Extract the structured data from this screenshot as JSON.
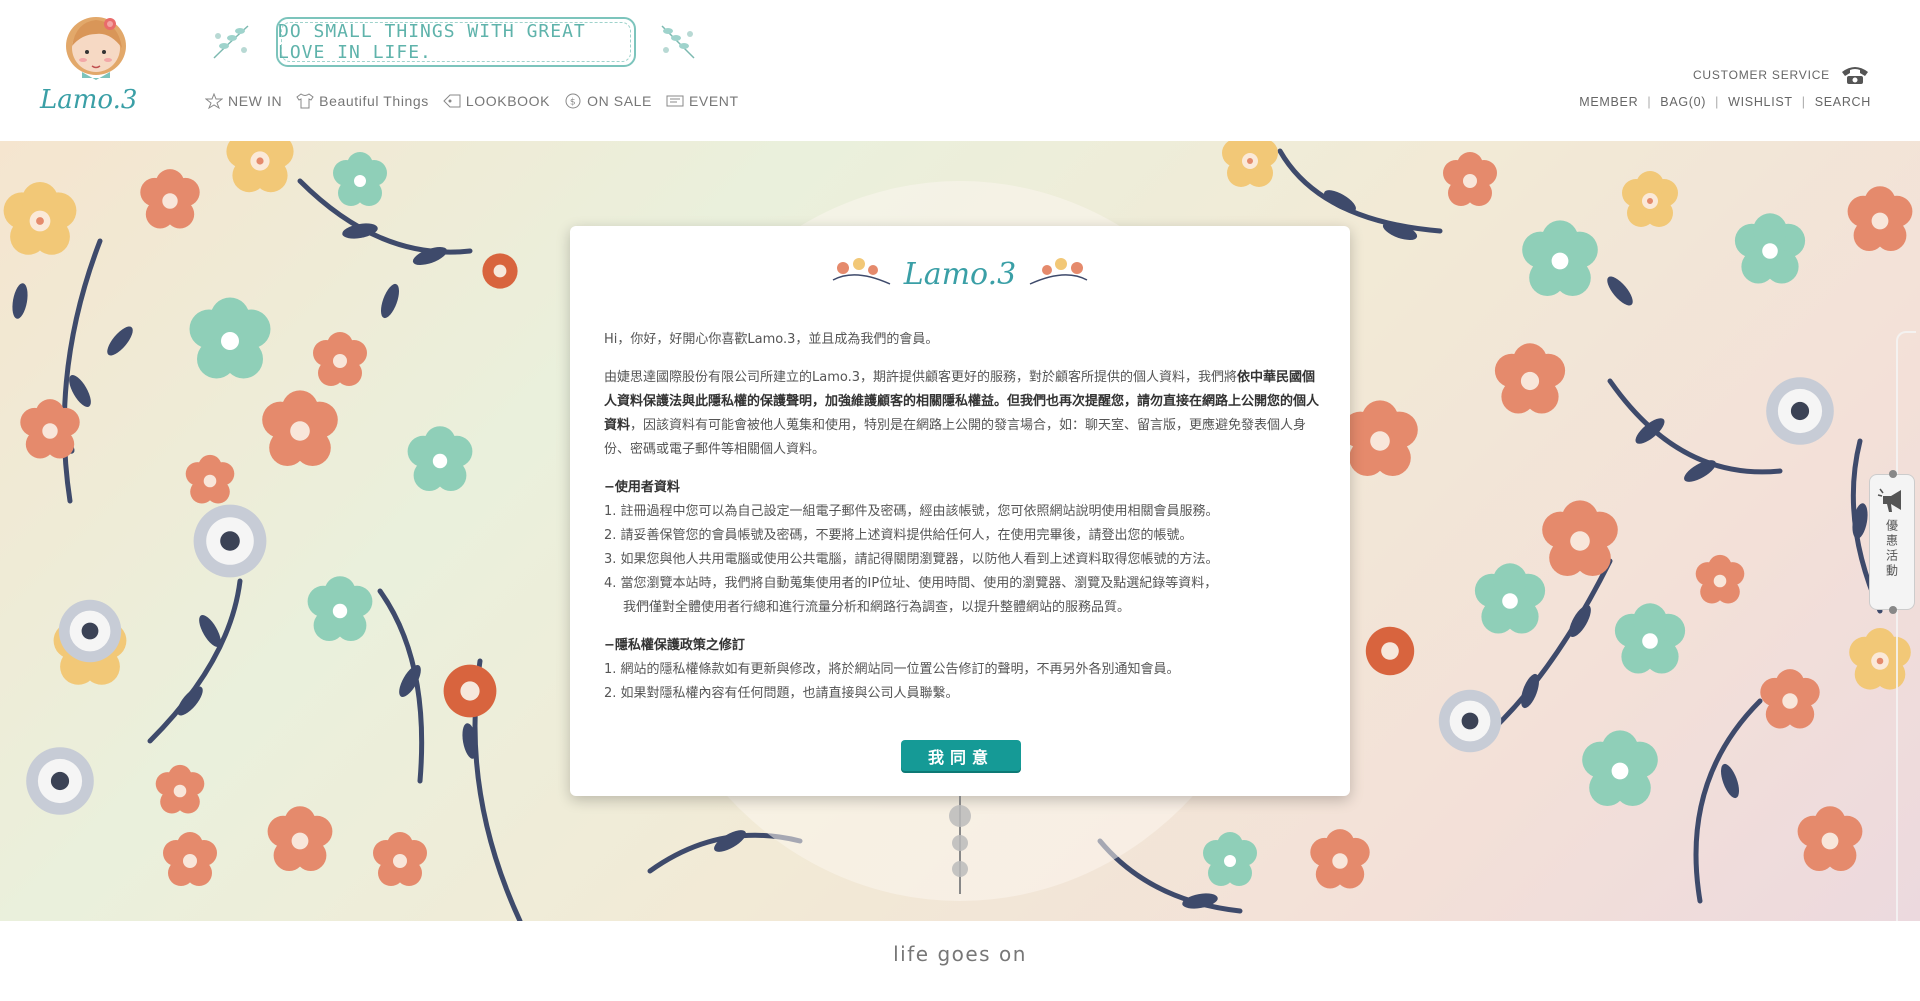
{
  "header": {
    "tagline": "DO SMALL THINGS WITH GREAT LOVE IN LIFE.",
    "brand": "Lamo.3",
    "nav": [
      {
        "label": "NEW IN",
        "icon": "star-icon"
      },
      {
        "label": "Beautiful Things",
        "icon": "shirt-icon"
      },
      {
        "label": "LOOKBOOK",
        "icon": "tag-icon"
      },
      {
        "label": "ON SALE",
        "icon": "coin-icon"
      },
      {
        "label": "EVENT",
        "icon": "ticket-icon"
      }
    ],
    "customer_service": "CUSTOMER SERVICE",
    "util": {
      "member": "MEMBER",
      "bag": "BAG(0)",
      "wishlist": "WISHLIST",
      "search": "SEARCH"
    }
  },
  "modal": {
    "brand": "Lamo.3",
    "greeting": "Hi，你好，好開心你喜歡Lamo.3，並且成為我們的會員。",
    "intro_1": "由婕思達國際股份有限公司所建立的Lamo.3，期許提供顧客更好的服務，對於顧客所提供的個人資料，我們將",
    "intro_bold_1": "依中華民國個人資料保護法與此隱私權的保護聲明，加強維護顧客的相關隱私權益。但我們也再次提醒您，請勿直接在網路上公開您的個人資料",
    "intro_2": "，因該資料有可能會被他人蒐集和使用，特別是在網路上公開的發言場合，如：聊天室、留言版，更應避免發表個人身份、密碼或電子郵件等相關個人資料。",
    "section1_title": "−使用者資料",
    "section1_items": [
      "1. 註冊過程中您可以為自己設定一組電子郵件及密碼，經由該帳號，您可依照網站說明使用相關會員服務。",
      "2. 請妥善保管您的會員帳號及密碼，不要將上述資料提供給任何人，在使用完畢後，請登出您的帳號。",
      "3. 如果您與他人共用電腦或使用公共電腦，請記得關閉瀏覽器，以防他人看到上述資料取得您帳號的方法。",
      "4. 當您瀏覽本站時，我們將自動蒐集使用者的IP位址、使用時間、使用的瀏覽器、瀏覽及點選紀錄等資料，"
    ],
    "section1_item4_cont": "我們僅對全體使用者行總和進行流量分析和網路行為調查，以提升整體網站的服務品質。",
    "section2_title": "−隱私權保護政策之修訂",
    "section2_items": [
      "1. 網站的隱私權條款如有更新與修改，將於網站同一位置公告修訂的聲明，不再另外各別通知會員。",
      "2. 如果對隱私權內容有任何問題，也請直接與公司人員聯繫。"
    ],
    "agree_button": "我同意"
  },
  "side_promo": {
    "label": "優惠活動",
    "icon": "megaphone-icon"
  },
  "footer": {
    "text": "life goes on"
  },
  "colors": {
    "accent": "#159a96",
    "tagline": "#5fb3ab",
    "brand": "#3a9fa6"
  }
}
